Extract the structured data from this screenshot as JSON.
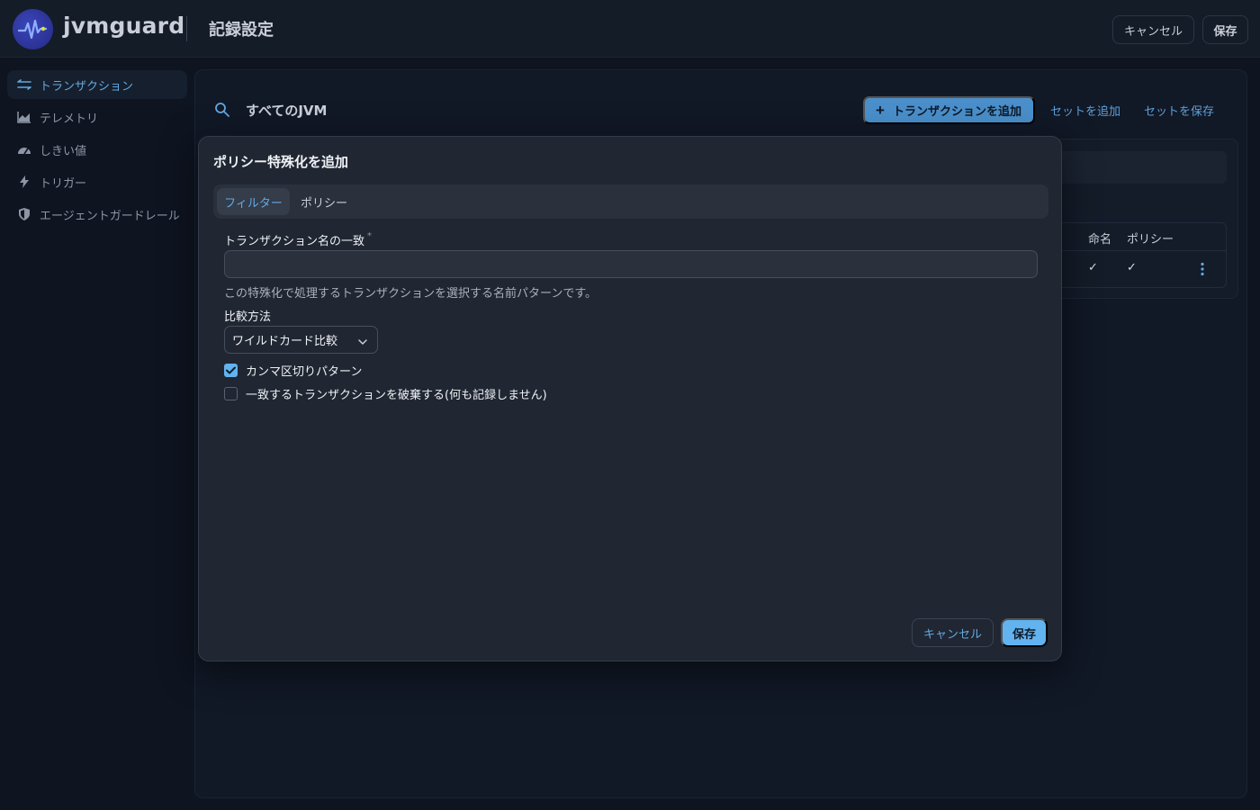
{
  "app": {
    "brand": "jvmguard",
    "page_title": "記録設定",
    "top_cancel": "キャンセル",
    "top_save": "保存"
  },
  "sidebar": {
    "items": [
      {
        "label": "トランザクション",
        "icon": "transfer-arrows-icon",
        "active": true
      },
      {
        "label": "テレメトリ",
        "icon": "area-chart-icon",
        "active": false
      },
      {
        "label": "しきい値",
        "icon": "gauge-icon",
        "active": false
      },
      {
        "label": "トリガー",
        "icon": "lightning-icon",
        "active": false
      },
      {
        "label": "エージェントガードレール",
        "icon": "shield-icon",
        "active": false
      }
    ]
  },
  "toolbar": {
    "jvm_selector": "すべてのJVM",
    "add_transaction": "トランザクションを追加",
    "add_set": "セットを追加",
    "save_set": "セットを保存"
  },
  "table": {
    "columns": [
      "命名",
      "ポリシー"
    ],
    "rows": [
      {
        "naming": "✓",
        "policy": "✓"
      }
    ]
  },
  "modal": {
    "title": "ポリシー特殊化を追加",
    "tabs": [
      "フィルター",
      "ポリシー"
    ],
    "active_tab": "フィルター",
    "name_match_label": "トランザクション名の一致",
    "required_mark": "*",
    "name_match_value": "",
    "name_match_help": "この特殊化で処理するトランザクションを選択する名前パターンです。",
    "compare_label": "比較方法",
    "compare_value": "ワイルドカード比較",
    "comma_separated_label": "カンマ区切りパターン",
    "comma_separated_checked": true,
    "discard_label": "一致するトランザクションを破棄する(何も記録しません)",
    "discard_checked": false,
    "cancel": "キャンセル",
    "save": "保存"
  },
  "colors": {
    "accent": "#62b3f0",
    "link": "#5e9fd6",
    "primary_button": "#4a8fcb",
    "background": "#0e1420",
    "modal": "#202632"
  }
}
